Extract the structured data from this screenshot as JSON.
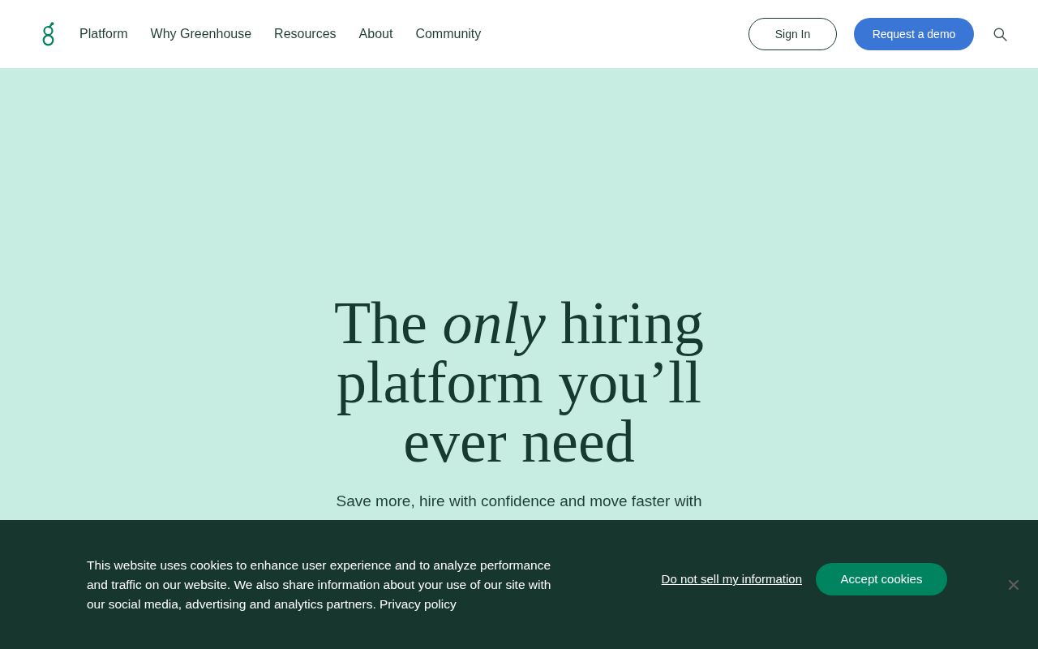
{
  "header": {
    "nav": [
      "Platform",
      "Why Greenhouse",
      "Resources",
      "About",
      "Community"
    ],
    "sign_in": "Sign In",
    "demo": "Request a demo"
  },
  "hero": {
    "headline": "The *only* hiring platform you’ll ever need",
    "subtitle": "Save more, hire with confidence and move faster with"
  },
  "cookie_banner": {
    "text": "This website uses cookies to enhance user experience and to analyze performance and traffic on our website. We also share information about your use of our site with our social media, advertising and analytics partners.",
    "privacy_link": "Privacy policy",
    "opt_out_link": "Do not sell my information",
    "accept": "Accept cookies"
  }
}
